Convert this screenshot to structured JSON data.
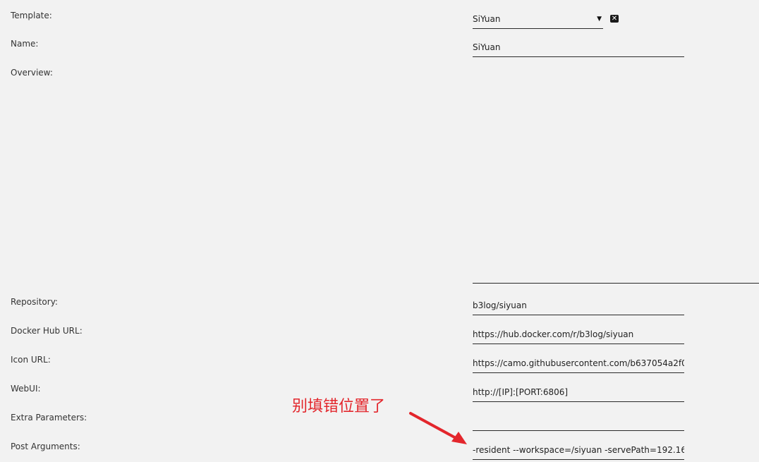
{
  "fields": {
    "template": {
      "label": "Template:",
      "value": "SiYuan"
    },
    "name": {
      "label": "Name:",
      "value": "SiYuan"
    },
    "overview": {
      "label": "Overview:",
      "value": ""
    },
    "repository": {
      "label": "Repository:",
      "value": "b3log/siyuan"
    },
    "docker_hub_url": {
      "label": "Docker Hub URL:",
      "value": "https://hub.docker.com/r/b3log/siyuan"
    },
    "icon_url": {
      "label": "Icon URL:",
      "value": "https://camo.githubusercontent.com/b637054a2f0"
    },
    "webui": {
      "label": "WebUI:",
      "value": "http://[IP]:[PORT:6806]"
    },
    "extra_parameters": {
      "label": "Extra Parameters:",
      "value": ""
    },
    "post_arguments": {
      "label": "Post Arguments:",
      "value": "-resident --workspace=/siyuan -servePath=192.16"
    }
  },
  "icons": {
    "dropdown": "caret-down-icon",
    "clear": "close-square-icon"
  },
  "annotation": {
    "text": "别填错位置了",
    "color": "#e3262c"
  }
}
